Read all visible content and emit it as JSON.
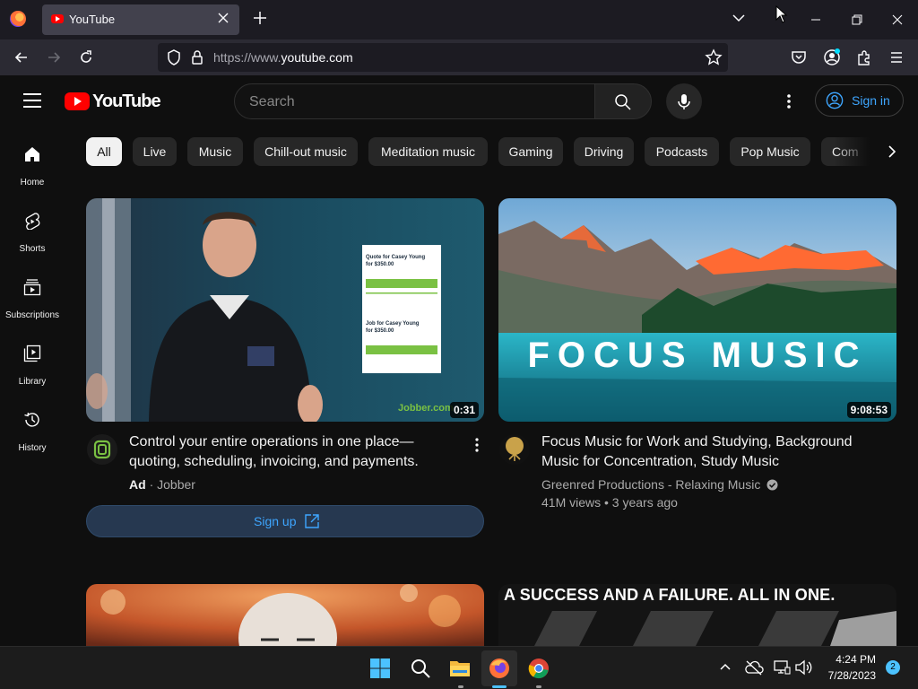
{
  "browser": {
    "tab_title": "YouTube",
    "url_dim": "https://www.",
    "url_host": "youtube.com"
  },
  "header": {
    "logo_text": "YouTube",
    "search_placeholder": "Search",
    "signin_label": "Sign in"
  },
  "sidebar": {
    "items": [
      {
        "label": "Home",
        "icon": "home-icon"
      },
      {
        "label": "Shorts",
        "icon": "shorts-icon"
      },
      {
        "label": "Subscriptions",
        "icon": "subscriptions-icon"
      },
      {
        "label": "Library",
        "icon": "library-icon"
      },
      {
        "label": "History",
        "icon": "history-icon"
      }
    ]
  },
  "chips": [
    "All",
    "Live",
    "Music",
    "Chill-out music",
    "Meditation music",
    "Gaming",
    "Driving",
    "Podcasts",
    "Pop Music",
    "Com"
  ],
  "videos": [
    {
      "title_line1": "Control your entire operations in one place—",
      "title_line2": "quoting, scheduling, invoicing, and payments.",
      "ad_badge": "Ad",
      "ad_dot": "·",
      "channel": "Jobber",
      "duration": "0:31",
      "watermark": "Jobber.com",
      "cta": "Sign up",
      "mock_quote_1": "Quote for Casey Young",
      "mock_quote_2": "for $350.00",
      "mock_job_1": "Job for Casey Young",
      "mock_job_2": "for $350.00"
    },
    {
      "title_line1": "Focus Music for Work and Studying, Background",
      "title_line2": "Music for Concentration, Study Music",
      "channel": "Greenred Productions - Relaxing Music",
      "stats": "41M views • 3 years ago",
      "duration": "9:08:53",
      "overlay_text": "FOCUS MUSIC"
    },
    {
      "overlay_text": "A SUCCESS AND A FAILURE. ALL IN ONE."
    }
  ],
  "taskbar": {
    "time": "4:24 PM",
    "date": "7/28/2023",
    "notifications": "2"
  },
  "colors": {
    "accent_blue": "#3ea6ff",
    "yt_red": "#ff0000",
    "bg": "#0f0f0f"
  }
}
